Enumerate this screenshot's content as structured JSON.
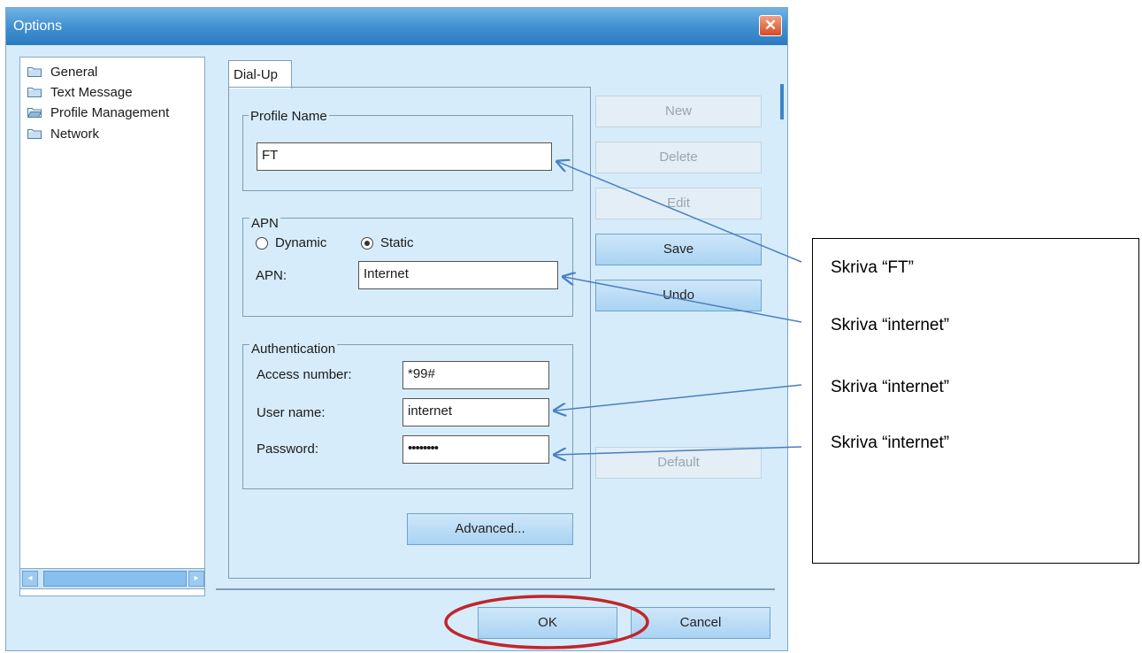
{
  "window": {
    "title": "Options",
    "close_label": "✕"
  },
  "tree": {
    "items": [
      {
        "label": "General",
        "icon": "folder-icon"
      },
      {
        "label": "Text Message",
        "icon": "folder-icon"
      },
      {
        "label": "Profile Management",
        "icon": "open-folder-icon"
      },
      {
        "label": "Network",
        "icon": "folder-icon"
      }
    ],
    "scroll_left": "◂",
    "scroll_right": "▸"
  },
  "tab": {
    "label": "Dial-Up"
  },
  "profile": {
    "legend": "Profile Name",
    "value": "FT"
  },
  "apn": {
    "legend": "APN",
    "radio_dynamic": "Dynamic",
    "radio_static": "Static",
    "selected": "Static",
    "apn_label": "APN:",
    "apn_value": "Internet"
  },
  "auth": {
    "legend": "Authentication",
    "access_label": "Access number:",
    "access_value": "*99#",
    "user_label": "User name:",
    "user_value": "internet",
    "password_label": "Password:",
    "password_value": "••••••••"
  },
  "buttons": {
    "new": "New",
    "delete": "Delete",
    "edit": "Edit",
    "save": "Save",
    "undo": "Undo",
    "default": "Default",
    "advanced": "Advanced...",
    "ok": "OK",
    "cancel": "Cancel"
  },
  "annotations": [
    "Skriva “FT”",
    "Skriva “internet”",
    "Skriva “internet”",
    "Skriva “internet”"
  ],
  "colors": {
    "arrow": "#4a7fc1",
    "highlight_ellipse": "#c0262d",
    "window_bg": "#d6ecfa"
  }
}
